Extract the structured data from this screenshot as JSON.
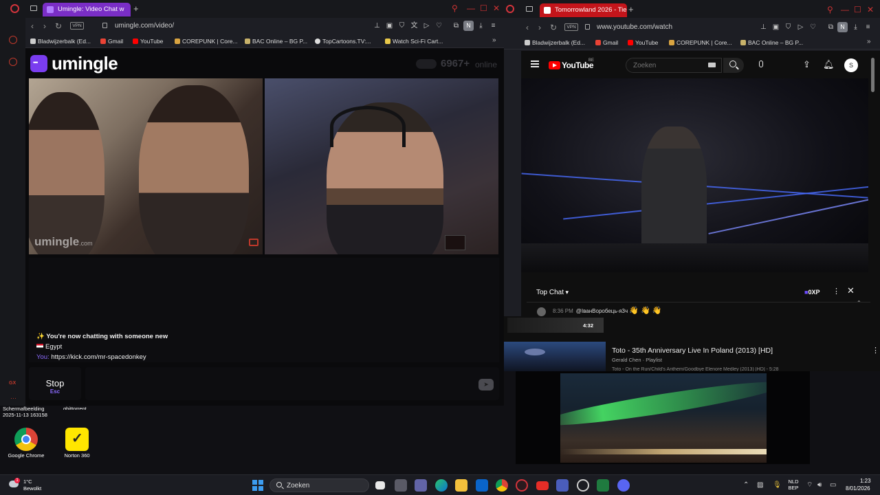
{
  "umingle_window": {
    "tab_title": "Umingle: Video Chat w",
    "url": "umingle.com/video/",
    "vpn": "VPN",
    "profile_initial": "N",
    "bookmarks": [
      "Bladwijzerbalk (Ed...",
      "Gmail",
      "YouTube",
      "COREPUNK | Core...",
      "BAC Online – BG P...",
      "TopCartoons.TV:...",
      "Watch Sci-Fi Cart..."
    ],
    "logo": "umingle",
    "online_count": "6967",
    "online_plus": "+",
    "online_label": "online",
    "watermark": "umingle",
    "watermark_tld": ".com",
    "chat": {
      "status": "✨ You're now chatting with someone new",
      "country": "Egypt",
      "you_label": "You:",
      "you_message": "https://kick.com/mr-spacedonkey"
    },
    "stop_label": "Stop",
    "stop_hotkey": "Esc"
  },
  "youtube_window": {
    "tab_title": "Tomorrowland 2026 - Tie",
    "url": "www.youtube.com/watch",
    "vpn": "VPN",
    "profile_initial": "N",
    "bookmarks": [
      "Bladwijzerbalk (Ed...",
      "Gmail",
      "YouTube",
      "COREPUNK | Core...",
      "BAC Online – BG P..."
    ],
    "logo": "YouTube",
    "region": "BE",
    "search_placeholder": "Zoeken",
    "avatar_initial": "S",
    "chat_header": "Top Chat",
    "xp_label": "0XP",
    "chat_message_time": "8:36 PM",
    "chat_message_author": "@ІванВоробець-я3ч",
    "chat_message_emoji": "👋 👋 👋",
    "duration": "4:32",
    "playlist_title": "Toto - 35th Anniversary Live In Poland (2013) [HD]",
    "playlist_channel": "Gerald Chen · Playlist",
    "playlist_next": "Toto - On the Run/Child's Anthem/Goodbye Elenore Medley (2013) [HD] - 5:28"
  },
  "desktop": {
    "screenshot_label_line1": "Schermafbeelding",
    "screenshot_label_line2": "2025-11-13 163158",
    "other_label": "qbittorrent",
    "chrome_label": "Google Chrome",
    "norton_label": "Norton 360"
  },
  "taskbar": {
    "weather_temp": "1°C",
    "weather_desc": "Bewolkt",
    "search_label": "Zoeken",
    "lang_line1": "NLD",
    "lang_line2": "BEP",
    "time": "1:23",
    "date": "8/01/2026"
  }
}
